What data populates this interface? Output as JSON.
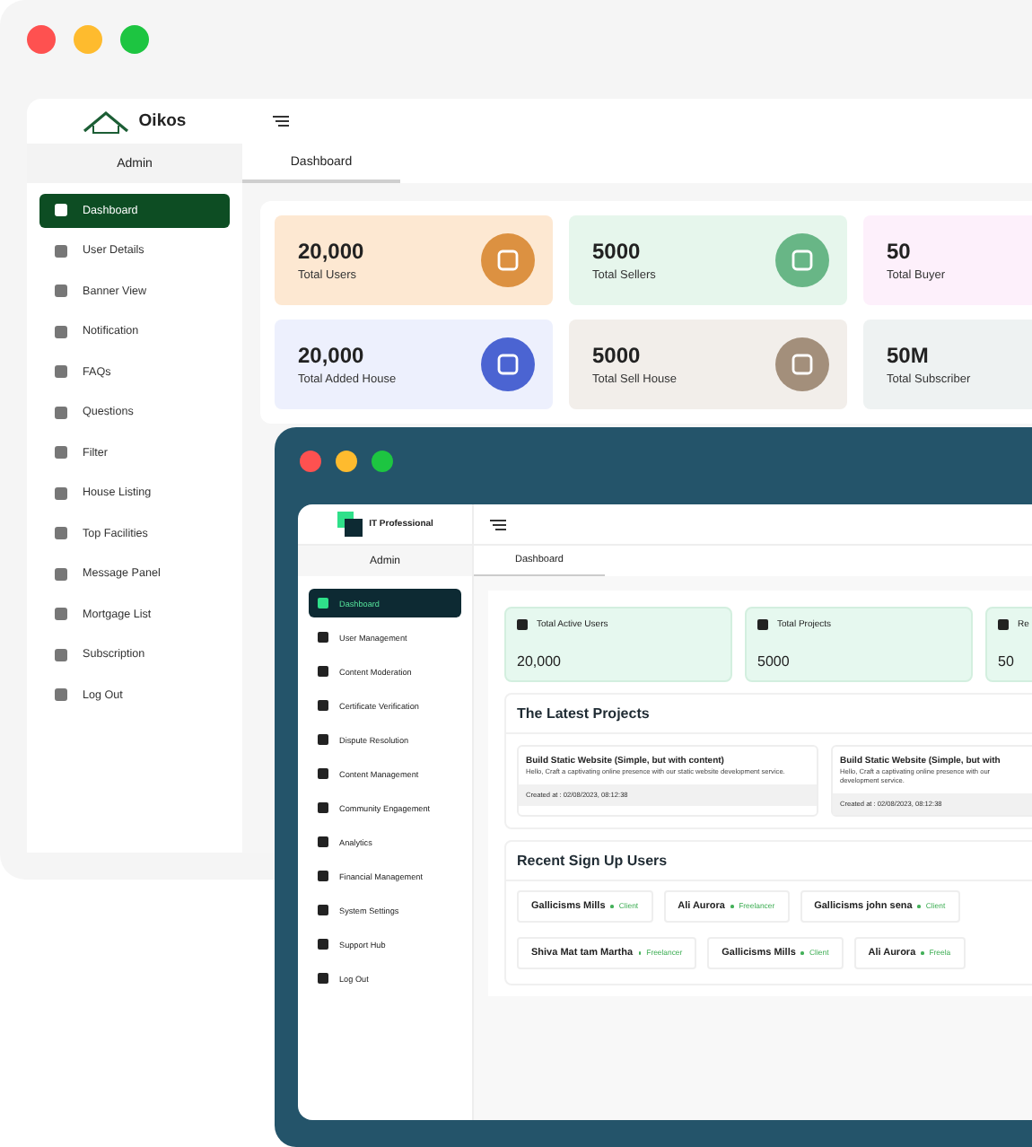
{
  "back_window": {
    "brand": "Oikos",
    "sidebar_title": "Admin",
    "tabs": [
      {
        "label": "Dashboard",
        "selected": true
      }
    ],
    "sidebar": {
      "items": [
        {
          "label": "Dashboard",
          "selected": true
        },
        {
          "label": "User Details",
          "selected": false
        },
        {
          "label": "Banner View",
          "selected": false
        },
        {
          "label": "Notification",
          "selected": false
        },
        {
          "label": "FAQs",
          "selected": false
        },
        {
          "label": "Questions",
          "selected": false
        },
        {
          "label": "Filter",
          "selected": false
        },
        {
          "label": "House Listing",
          "selected": false
        },
        {
          "label": "Top Facilities",
          "selected": false
        },
        {
          "label": "Message Panel",
          "selected": false
        },
        {
          "label": "Mortgage List",
          "selected": false
        },
        {
          "label": "Subscription",
          "selected": false
        },
        {
          "label": "Log Out",
          "selected": false
        }
      ]
    },
    "stats": [
      {
        "value": "20,000",
        "label": "Total Users",
        "color": "#fde8d2"
      },
      {
        "value": "5000",
        "label": "Total Sellers",
        "color": "#e6f6ec"
      },
      {
        "value": "50",
        "label": "Total Buyer",
        "color": "#fdf0fb"
      },
      {
        "value": "20,000",
        "label": "Total Added House",
        "color": "#edf0fd"
      },
      {
        "value": "5000",
        "label": "Total Sell House",
        "color": "#f2eeea"
      },
      {
        "value": "50M",
        "label": "Total Subscriber",
        "color": "#eef2f2"
      }
    ]
  },
  "front_window": {
    "brand": "IT Professional",
    "sidebar_title": "Admin",
    "tabs": [
      {
        "label": "Dashboard",
        "selected": true
      }
    ],
    "sidebar": {
      "items": [
        {
          "label": "Dashboard",
          "selected": true
        },
        {
          "label": "User Management",
          "selected": false
        },
        {
          "label": "Content Moderation",
          "selected": false
        },
        {
          "label": "Certificate Verification",
          "selected": false
        },
        {
          "label": "Dispute Resolution",
          "selected": false
        },
        {
          "label": "Content Management",
          "selected": false
        },
        {
          "label": "Community Engagement",
          "selected": false
        },
        {
          "label": "Analytics",
          "selected": false
        },
        {
          "label": "Financial Management",
          "selected": false
        },
        {
          "label": "System Settings",
          "selected": false
        },
        {
          "label": "Support Hub",
          "selected": false
        },
        {
          "label": "Log Out",
          "selected": false
        }
      ]
    },
    "stats": [
      {
        "label": "Total Active Users",
        "value": "20,000"
      },
      {
        "label": "Total Projects",
        "value": "5000"
      },
      {
        "label": "Re",
        "value": "50"
      }
    ],
    "latest_projects": {
      "title": "The Latest Projects",
      "items": [
        {
          "title": "Build Static Website (Simple, but with content)",
          "description": "Hello, Craft a captivating online presence with our static website development service.",
          "created": "Created at :  02/08/2023, 08:12:38"
        },
        {
          "title": "Build Static Website (Simple, but with",
          "description": "Hello, Craft a captivating online presence with our development service.",
          "created": "Created at :  02/08/2023, 08:12:38"
        }
      ]
    },
    "recent_users": {
      "title": "Recent Sign Up Users",
      "rows": [
        [
          {
            "name": "Gallicisms Mills",
            "role": "Client"
          },
          {
            "name": "Ali Aurora",
            "role": "Freelancer"
          },
          {
            "name": "Gallicisms john sena",
            "role": "Client"
          }
        ],
        [
          {
            "name": "Shiva Mat tam Martha",
            "role": "Freelancer"
          },
          {
            "name": "Gallicisms Mills",
            "role": "Client"
          },
          {
            "name": "Ali Aurora",
            "role": "Freela"
          }
        ]
      ]
    }
  }
}
